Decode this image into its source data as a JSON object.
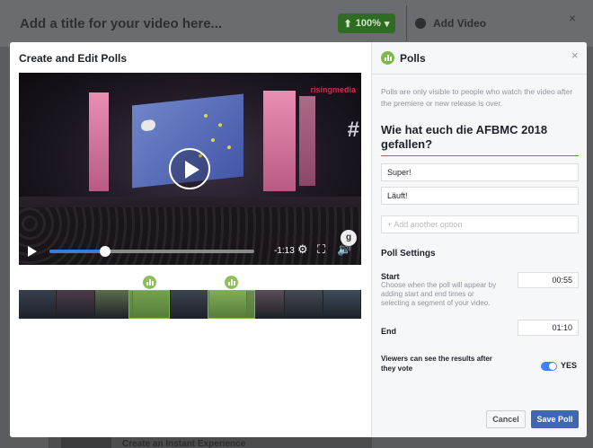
{
  "background": {
    "title": "Add a title for your video here...",
    "progress": "100%",
    "add_video": "Add Video",
    "close": "×",
    "bottom_item": "Create an Instant Experience"
  },
  "dialog": {
    "title": "Create and Edit Polls",
    "video": {
      "brand": "risingmedia",
      "hash": "#",
      "time_remaining": "-1:13",
      "progress_fraction": 0.27,
      "badge": "g"
    },
    "timeline": {
      "frames": [
        "#37404f",
        "#4a3b48",
        "#5a6e4b",
        "#6b7f5a",
        "#3b4450",
        "#8a9d6e",
        "#5a4e55",
        "#444a52",
        "#3e4c5c"
      ],
      "markers": [
        0.38,
        0.62
      ],
      "selection": {
        "start": 0.32,
        "end": 0.44
      },
      "selection2": {
        "start": 0.55,
        "end": 0.69
      }
    }
  },
  "panel": {
    "title": "Polls",
    "close": "×",
    "note": "Polls are only visible to people who watch the video after the premiere or new release is over.",
    "question": "Wie hat euch die AFBMC 2018 gefallen?",
    "options": [
      "Super!",
      "Läuft!"
    ],
    "add_option_placeholder": "+ Add another option",
    "settings_title": "Poll Settings",
    "start_label": "Start",
    "start_desc": "Choose when the poll will appear by adding start and end times or selecting a segment of your video.",
    "start_time": "00:55",
    "end_label": "End",
    "end_time": "01:10",
    "viewers_label": "Viewers can see the results after they vote",
    "viewers_toggle": "YES",
    "cancel": "Cancel",
    "save": "Save Poll"
  },
  "colors": {
    "accent": "#4267b2",
    "poll_green": "#7cb947",
    "seek_blue": "#3d7bd8"
  }
}
